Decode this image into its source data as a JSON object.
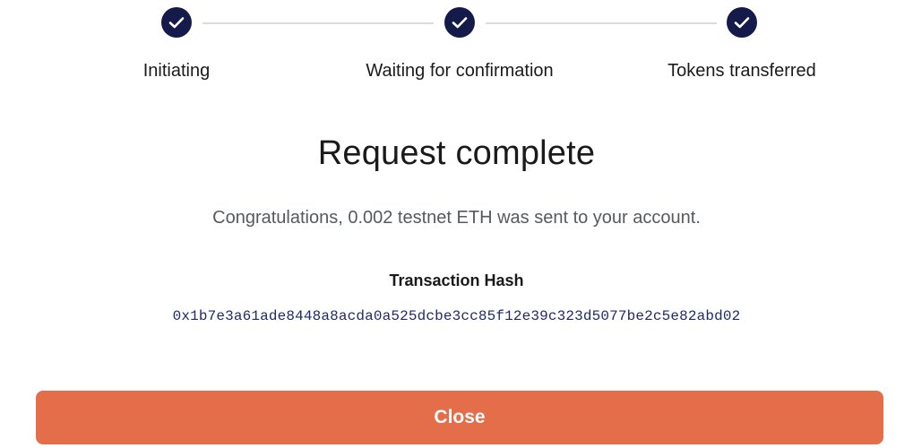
{
  "stepper": {
    "steps": [
      {
        "label": "Initiating",
        "status": "complete",
        "icon": "check-icon"
      },
      {
        "label": "Waiting for confirmation",
        "status": "complete",
        "icon": "check-icon"
      },
      {
        "label": "Tokens transferred",
        "status": "complete",
        "icon": "check-icon"
      }
    ]
  },
  "dialog": {
    "title": "Request complete",
    "message": "Congratulations, 0.002 testnet ETH was sent to your account.",
    "hash_label": "Transaction Hash",
    "hash_value": "0x1b7e3a61ade8448a8acda0a525dcbe3cc85f12e39c323d5077be2c5e82abd02",
    "close_label": "Close"
  },
  "colors": {
    "step_icon_bg": "#141a4a",
    "connector": "#dcdcdc",
    "accent_button": "#e46e4a",
    "hash_text": "#1e2a6e"
  }
}
